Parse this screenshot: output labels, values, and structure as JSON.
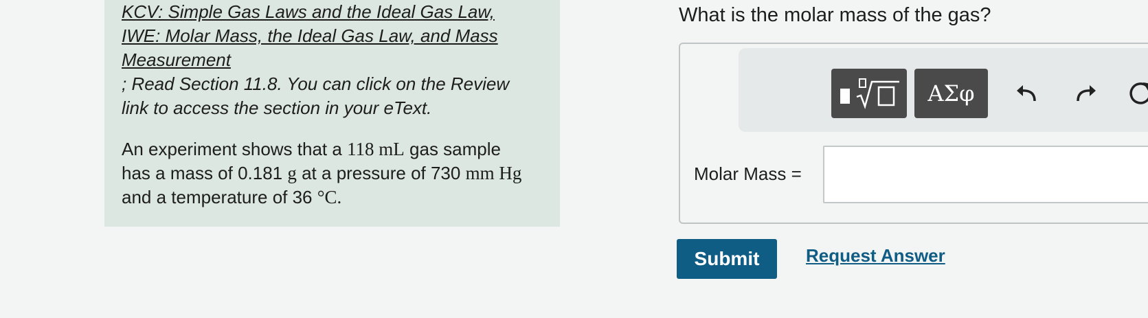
{
  "hint": {
    "link_line1": "KCV: Simple Gas Laws and the Ideal Gas Law,",
    "link_line2": "IWE: Molar Mass, the Ideal Gas Law, and Mass",
    "link_line3": "Measurement",
    "text_line1": "; Read Section 11.8. You can click on the Review",
    "text_line2": "link to access the section in your eText."
  },
  "problem": {
    "p1": "An experiment shows that a ",
    "volume": "118 mL",
    "p2": " gas sample has a mass of 0.181 ",
    "mass_unit": "g",
    "p3": " at a pressure of 730 ",
    "pressure_unit": "mm Hg",
    "p4": " and a temperature of 36 ",
    "temp_unit": "°C.",
    "p5": ""
  },
  "question": "What is the molar mass of the gas?",
  "toolbar": {
    "greek_label": "ΑΣφ"
  },
  "answer": {
    "label": "Molar Mass =",
    "value": ""
  },
  "actions": {
    "submit_label": "Submit",
    "request_label": "Request Answer"
  }
}
